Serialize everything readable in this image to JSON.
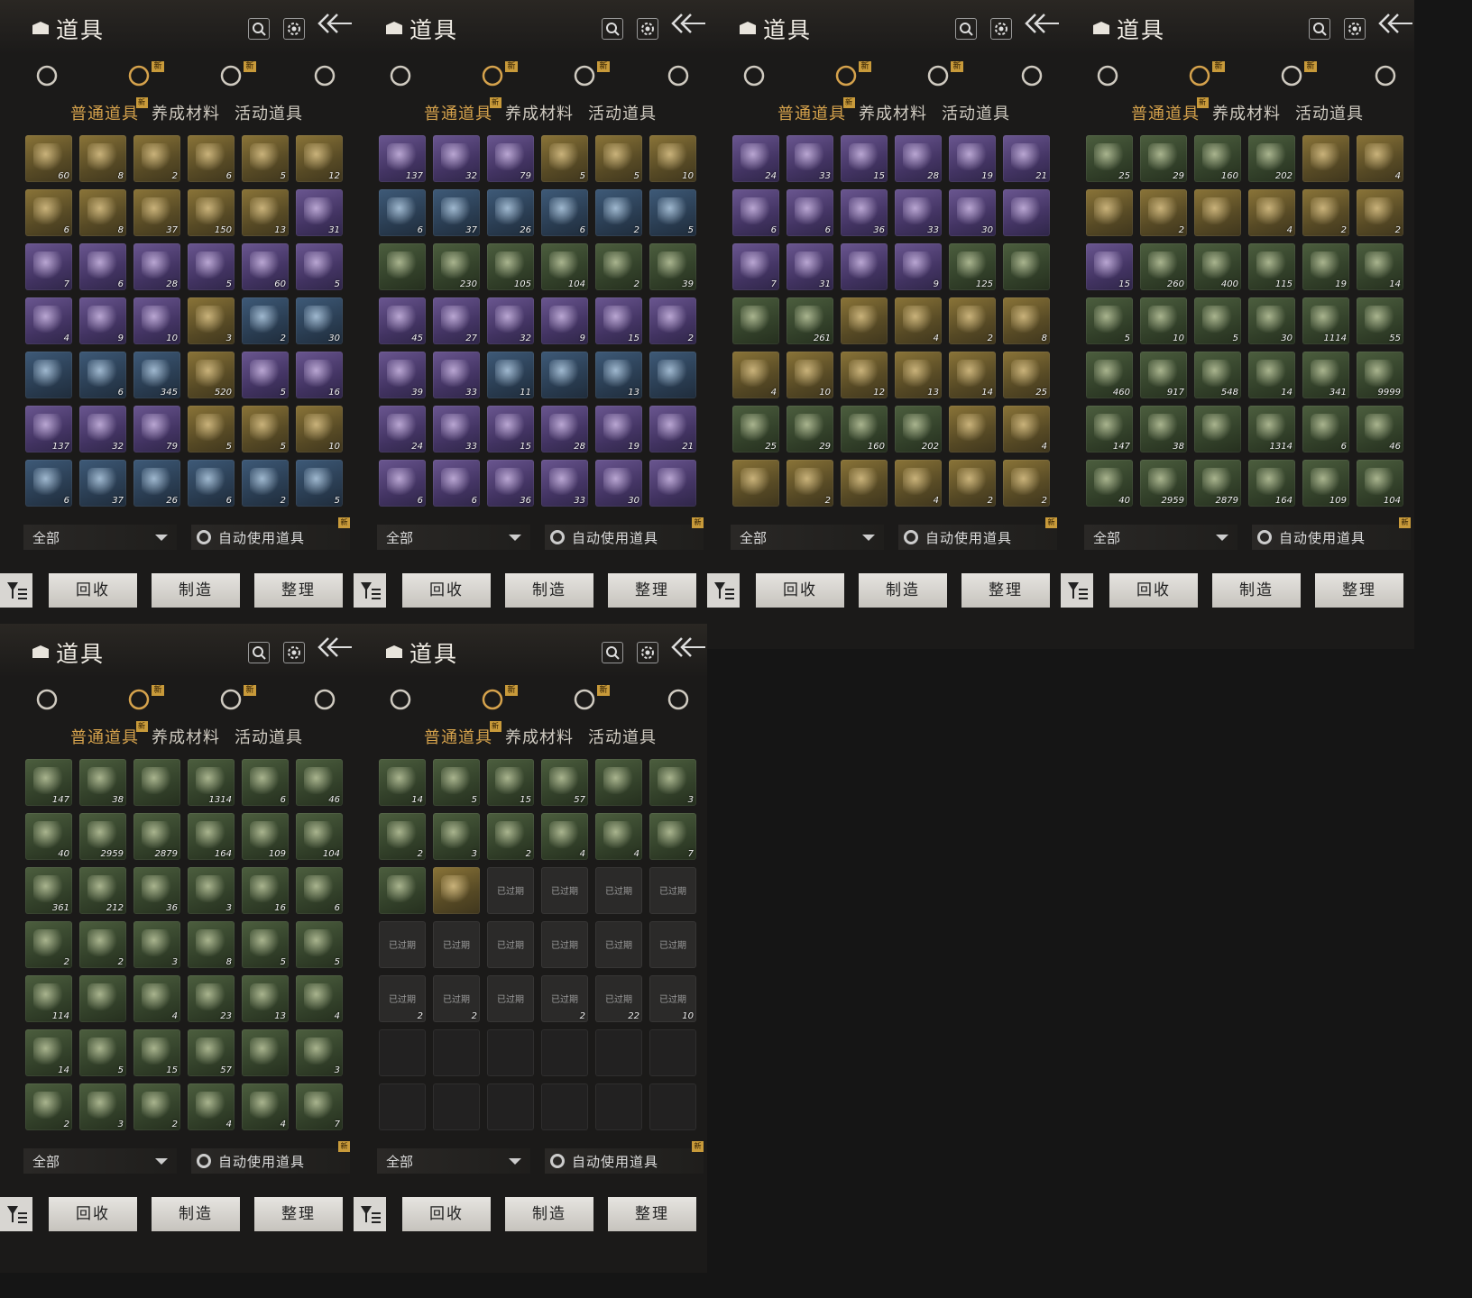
{
  "ui": {
    "title": "道具",
    "categories": [
      "weapon-icon",
      "bag-icon",
      "scroll-icon",
      "medal-icon"
    ],
    "new_badge": "新",
    "sub_tabs": [
      "普通道具",
      "养成材料",
      "活动道具"
    ],
    "filter_value": "全部",
    "auto_use_label": "自动使用道具",
    "buttons": [
      "回收",
      "制造",
      "整理"
    ],
    "expired_label": "已过期"
  },
  "panels": [
    {
      "grid": [
        [
          [
            "g",
            "60"
          ],
          [
            "g",
            "8"
          ],
          [
            "g",
            "2"
          ],
          [
            "g",
            "6"
          ],
          [
            "g",
            "5"
          ],
          [
            "g",
            "12"
          ]
        ],
        [
          [
            "g",
            "6"
          ],
          [
            "g",
            "8"
          ],
          [
            "g",
            "37"
          ],
          [
            "g",
            "150"
          ],
          [
            "g",
            "13"
          ],
          [
            "p",
            "31"
          ]
        ],
        [
          [
            "p",
            "7"
          ],
          [
            "p",
            "6"
          ],
          [
            "p",
            "28"
          ],
          [
            "p",
            "5"
          ],
          [
            "p",
            "60"
          ],
          [
            "p",
            "5"
          ]
        ],
        [
          [
            "p",
            "4"
          ],
          [
            "p",
            "9"
          ],
          [
            "p",
            "10"
          ],
          [
            "g",
            "3"
          ],
          [
            "b",
            "2"
          ],
          [
            "b",
            "30"
          ]
        ],
        [
          [
            "b",
            ""
          ],
          [
            "b",
            "6"
          ],
          [
            "b",
            "345"
          ],
          [
            "g",
            "520"
          ],
          [
            "p",
            "5"
          ],
          [
            "p",
            "16"
          ]
        ],
        [
          [
            "p",
            "137"
          ],
          [
            "p",
            "32"
          ],
          [
            "p",
            "79"
          ],
          [
            "g",
            "5"
          ],
          [
            "g",
            "5"
          ],
          [
            "g",
            "10"
          ]
        ],
        [
          [
            "b",
            "6"
          ],
          [
            "b",
            "37"
          ],
          [
            "b",
            "26"
          ],
          [
            "b",
            "6"
          ],
          [
            "b",
            "2"
          ],
          [
            "b",
            "5"
          ]
        ]
      ]
    },
    {
      "grid": [
        [
          [
            "p",
            "137"
          ],
          [
            "p",
            "32"
          ],
          [
            "p",
            "79"
          ],
          [
            "g",
            "5"
          ],
          [
            "g",
            "5"
          ],
          [
            "g",
            "10"
          ]
        ],
        [
          [
            "b",
            "6"
          ],
          [
            "b",
            "37"
          ],
          [
            "b",
            "26"
          ],
          [
            "b",
            "6"
          ],
          [
            "b",
            "2"
          ],
          [
            "b",
            "5"
          ]
        ],
        [
          [
            "n",
            ""
          ],
          [
            "n",
            "230"
          ],
          [
            "n",
            "105"
          ],
          [
            "n",
            "104"
          ],
          [
            "n",
            "2"
          ],
          [
            "n",
            "39"
          ]
        ],
        [
          [
            "p",
            "45"
          ],
          [
            "p",
            "27"
          ],
          [
            "p",
            "32"
          ],
          [
            "p",
            "9"
          ],
          [
            "p",
            "15"
          ],
          [
            "p",
            "2"
          ]
        ],
        [
          [
            "p",
            "39"
          ],
          [
            "p",
            "33"
          ],
          [
            "b",
            "11"
          ],
          [
            "b",
            ""
          ],
          [
            "b",
            "13"
          ],
          [
            "b",
            ""
          ]
        ],
        [
          [
            "p",
            "24"
          ],
          [
            "p",
            "33"
          ],
          [
            "p",
            "15"
          ],
          [
            "p",
            "28"
          ],
          [
            "p",
            "19"
          ],
          [
            "p",
            "21"
          ]
        ],
        [
          [
            "p",
            "6"
          ],
          [
            "p",
            "6"
          ],
          [
            "p",
            "36"
          ],
          [
            "p",
            "33"
          ],
          [
            "p",
            "30"
          ],
          [
            "p",
            ""
          ]
        ]
      ]
    },
    {
      "grid": [
        [
          [
            "p",
            "24"
          ],
          [
            "p",
            "33"
          ],
          [
            "p",
            "15"
          ],
          [
            "p",
            "28"
          ],
          [
            "p",
            "19"
          ],
          [
            "p",
            "21"
          ]
        ],
        [
          [
            "p",
            "6"
          ],
          [
            "p",
            "6"
          ],
          [
            "p",
            "36"
          ],
          [
            "p",
            "33"
          ],
          [
            "p",
            "30"
          ],
          [
            "p",
            ""
          ]
        ],
        [
          [
            "p",
            "7"
          ],
          [
            "p",
            "31"
          ],
          [
            "p",
            ""
          ],
          [
            "p",
            "9"
          ],
          [
            "n",
            "125"
          ],
          [
            "n",
            ""
          ]
        ],
        [
          [
            "n",
            ""
          ],
          [
            "n",
            "261"
          ],
          [
            "g",
            ""
          ],
          [
            "g",
            "4"
          ],
          [
            "g",
            "2"
          ],
          [
            "g",
            "8"
          ]
        ],
        [
          [
            "g",
            "4"
          ],
          [
            "g",
            "10"
          ],
          [
            "g",
            "12"
          ],
          [
            "g",
            "13"
          ],
          [
            "g",
            "14"
          ],
          [
            "g",
            "25"
          ]
        ],
        [
          [
            "n",
            "25"
          ],
          [
            "n",
            "29"
          ],
          [
            "n",
            "160"
          ],
          [
            "n",
            "202"
          ],
          [
            "g",
            ""
          ],
          [
            "g",
            "4"
          ]
        ],
        [
          [
            "g",
            ""
          ],
          [
            "g",
            "2"
          ],
          [
            "g",
            ""
          ],
          [
            "g",
            "4"
          ],
          [
            "g",
            "2"
          ],
          [
            "g",
            "2"
          ]
        ]
      ]
    },
    {
      "grid": [
        [
          [
            "n",
            "25"
          ],
          [
            "n",
            "29"
          ],
          [
            "n",
            "160"
          ],
          [
            "n",
            "202"
          ],
          [
            "g",
            ""
          ],
          [
            "g",
            "4"
          ]
        ],
        [
          [
            "g",
            ""
          ],
          [
            "g",
            "2"
          ],
          [
            "g",
            ""
          ],
          [
            "g",
            "4"
          ],
          [
            "g",
            "2"
          ],
          [
            "g",
            "2"
          ]
        ],
        [
          [
            "p",
            "15"
          ],
          [
            "n",
            "260"
          ],
          [
            "n",
            "400"
          ],
          [
            "n",
            "115"
          ],
          [
            "n",
            "19"
          ],
          [
            "n",
            "14"
          ]
        ],
        [
          [
            "n",
            "5"
          ],
          [
            "n",
            "10"
          ],
          [
            "n",
            "5"
          ],
          [
            "n",
            "30"
          ],
          [
            "n",
            "1114"
          ],
          [
            "n",
            "55"
          ]
        ],
        [
          [
            "n",
            "460"
          ],
          [
            "n",
            "917"
          ],
          [
            "n",
            "548"
          ],
          [
            "n",
            "14"
          ],
          [
            "n",
            "341"
          ],
          [
            "n",
            "9999"
          ]
        ],
        [
          [
            "n",
            "147"
          ],
          [
            "n",
            "38"
          ],
          [
            "n",
            ""
          ],
          [
            "n",
            "1314"
          ],
          [
            "n",
            "6"
          ],
          [
            "n",
            "46"
          ]
        ],
        [
          [
            "n",
            "40"
          ],
          [
            "n",
            "2959"
          ],
          [
            "n",
            "2879"
          ],
          [
            "n",
            "164"
          ],
          [
            "n",
            "109"
          ],
          [
            "n",
            "104"
          ]
        ]
      ]
    },
    {
      "grid": [
        [
          [
            "n",
            "147"
          ],
          [
            "n",
            "38"
          ],
          [
            "n",
            ""
          ],
          [
            "n",
            "1314"
          ],
          [
            "n",
            "6"
          ],
          [
            "n",
            "46"
          ]
        ],
        [
          [
            "n",
            "40"
          ],
          [
            "n",
            "2959"
          ],
          [
            "n",
            "2879"
          ],
          [
            "n",
            "164"
          ],
          [
            "n",
            "109"
          ],
          [
            "n",
            "104"
          ]
        ],
        [
          [
            "n",
            "361"
          ],
          [
            "n",
            "212"
          ],
          [
            "n",
            "36"
          ],
          [
            "n",
            "3"
          ],
          [
            "n",
            "16"
          ],
          [
            "n",
            "6"
          ]
        ],
        [
          [
            "n",
            "2"
          ],
          [
            "n",
            "2"
          ],
          [
            "n",
            "3"
          ],
          [
            "n",
            "8"
          ],
          [
            "n",
            "5"
          ],
          [
            "n",
            "5"
          ]
        ],
        [
          [
            "n",
            "114"
          ],
          [
            "n",
            ""
          ],
          [
            "n",
            "4"
          ],
          [
            "n",
            "23"
          ],
          [
            "n",
            "13"
          ],
          [
            "n",
            "4"
          ]
        ],
        [
          [
            "n",
            "14"
          ],
          [
            "n",
            "5"
          ],
          [
            "n",
            "15"
          ],
          [
            "n",
            "57"
          ],
          [
            "n",
            ""
          ],
          [
            "n",
            "3"
          ]
        ],
        [
          [
            "n",
            "2"
          ],
          [
            "n",
            "3"
          ],
          [
            "n",
            "2"
          ],
          [
            "n",
            "4"
          ],
          [
            "n",
            "4"
          ],
          [
            "n",
            "7"
          ]
        ]
      ]
    },
    {
      "grid": [
        [
          [
            "n",
            "14"
          ],
          [
            "n",
            "5"
          ],
          [
            "n",
            "15"
          ],
          [
            "n",
            "57"
          ],
          [
            "n",
            ""
          ],
          [
            "n",
            "3"
          ]
        ],
        [
          [
            "n",
            "2"
          ],
          [
            "n",
            "3"
          ],
          [
            "n",
            "2"
          ],
          [
            "n",
            "4"
          ],
          [
            "n",
            "4"
          ],
          [
            "n",
            "7"
          ]
        ],
        [
          [
            "n",
            ""
          ],
          [
            "g",
            ""
          ],
          [
            "x",
            ""
          ],
          [
            "x",
            ""
          ],
          [
            "x",
            ""
          ],
          [
            "x",
            ""
          ]
        ],
        [
          [
            "x",
            ""
          ],
          [
            "x",
            ""
          ],
          [
            "x",
            ""
          ],
          [
            "x",
            ""
          ],
          [
            "x",
            ""
          ],
          [
            "x",
            ""
          ]
        ],
        [
          [
            "x",
            "2"
          ],
          [
            "x",
            "2"
          ],
          [
            "x",
            ""
          ],
          [
            "x",
            "2"
          ],
          [
            "x",
            "22"
          ],
          [
            "x",
            "10"
          ]
        ],
        [
          [
            "e",
            ""
          ],
          [
            "e",
            ""
          ],
          [
            "e",
            ""
          ],
          [
            "e",
            ""
          ],
          [
            "e",
            ""
          ],
          [
            "e",
            ""
          ]
        ],
        [
          [
            "e",
            ""
          ],
          [
            "e",
            ""
          ],
          [
            "e",
            ""
          ],
          [
            "e",
            ""
          ],
          [
            "e",
            ""
          ],
          [
            "e",
            ""
          ]
        ]
      ]
    }
  ]
}
